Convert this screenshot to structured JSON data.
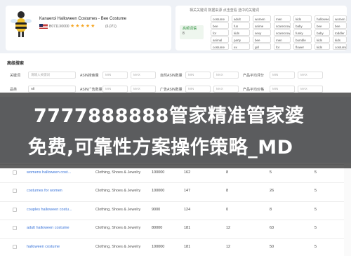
{
  "product": {
    "title": "Kanaeroi Halloween Costumes - Bee Costume",
    "asin": "B0711X0000",
    "stars": "★★★★★",
    "rating_count": "(6,071)"
  },
  "keyword_panel": {
    "header": "相关关键词 数据来源 点击查看 选中的关键词",
    "badge_label": "高频词语",
    "badge_value": "8",
    "chips": [
      [
        "costume",
        "adult",
        "women",
        "men",
        "kids",
        "halloween",
        "women"
      ],
      [
        "bee",
        "fun",
        "anime",
        "scarecrow",
        "baby",
        "bee",
        "bee"
      ],
      [
        "for",
        "kids",
        "sexy",
        "scarecrow",
        "funky",
        "baby",
        "toddler"
      ],
      [
        "animal",
        "party",
        "bee",
        "men",
        "bumble",
        "kids",
        "kids"
      ],
      [
        "costume",
        "ex",
        "girl",
        "for",
        "flower",
        "kids",
        "costume"
      ]
    ]
  },
  "search": {
    "title": "高级搜索",
    "fields": [
      {
        "label": "关键词",
        "value": "请输入关键词"
      },
      {
        "label": "ASIN搜索量",
        "value": "MIN"
      },
      {
        "label": "自然ASIN数量",
        "value": "MIN"
      },
      {
        "label": "产品平均评分",
        "value": "MIN"
      },
      {
        "label": "品类",
        "value": "All"
      },
      {
        "label": "ASIN广告数量",
        "value": "MIN"
      },
      {
        "label": "广告ASIN数量",
        "value": "MIN"
      },
      {
        "label": "产品平均价格",
        "value": "MIN"
      }
    ],
    "max_placeholder": "MAX"
  },
  "banner": {
    "line1": "7777888888管家精准管家婆",
    "line2": "免费,可靠性方案操作策略_MD"
  },
  "table": {
    "rows": [
      {
        "keyword": "womens halloween cost...",
        "category": "Clothing, Shoes & Jewelry",
        "volume": "100000",
        "c4": "162",
        "c5": "8",
        "c6": "5",
        "c7": "5"
      },
      {
        "keyword": "costumes for women",
        "category": "Clothing, Shoes & Jewelry",
        "volume": "100000",
        "c4": "147",
        "c5": "8",
        "c6": "26",
        "c7": "5"
      },
      {
        "keyword": "couples halloween costu...",
        "category": "Clothing, Shoes & Jewelry",
        "volume": "9000",
        "c4": "124",
        "c5": "0",
        "c6": "8",
        "c7": "5"
      },
      {
        "keyword": "adult halloween costume",
        "category": "Clothing, Shoes & Jewelry",
        "volume": "80000",
        "c4": "181",
        "c5": "12",
        "c6": "63",
        "c7": "5"
      },
      {
        "keyword": "halloween costume",
        "category": "Clothing, Shoes & Jewelry",
        "volume": "100000",
        "c4": "181",
        "c5": "12",
        "c6": "50",
        "c7": "5"
      }
    ]
  },
  "colors": {
    "link": "#3a74d9",
    "star": "#f5a623",
    "badge": "#2a8f3a",
    "overlay": "#000000"
  }
}
